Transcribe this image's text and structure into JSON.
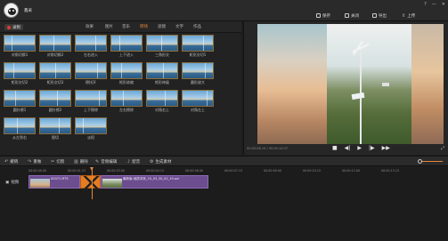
{
  "app": {
    "title": "鑫采"
  },
  "titlebar": {
    "actions": [
      {
        "label": "保存",
        "icon": "save-icon"
      },
      {
        "label": "关闭",
        "icon": "close-project-icon"
      },
      {
        "label": "导出",
        "icon": "export-icon"
      },
      {
        "label": "上传",
        "icon": "upload-icon"
      }
    ],
    "window_controls": [
      "?",
      "—",
      "✕"
    ]
  },
  "left_panel": {
    "record_button": "录制",
    "tabs": [
      "效果",
      "图片",
      "音乐",
      "转场",
      "滤镜",
      "文字",
      "作品"
    ],
    "active_tab": "转场",
    "transitions": [
      "对角切换1",
      "对角切换2",
      "左右进入",
      "上下进入",
      "三角形交",
      "矩形交切1",
      "矩形交切2",
      "矩形交切3",
      "擦拭开",
      "矩形收缩",
      "矩形伸展",
      "圆形放大",
      "圆针擦1",
      "圆针擦2",
      "上下擦除",
      "左右擦除",
      "对角右上",
      "对角左上",
      "从左到右",
      "图切",
      "淡阳"
    ]
  },
  "preview": {
    "time": "00:00:06.19 / 00:00:14.07",
    "controls": [
      "stop-icon",
      "prev-frame-icon",
      "play-icon",
      "next-frame-icon",
      "skip-end-icon"
    ]
  },
  "toolbar": {
    "items": [
      "撤销",
      "重做",
      "切割",
      "删除",
      "音频编辑",
      "配音",
      "生成素材"
    ]
  },
  "timeline": {
    "ticks": [
      "00:00:00.00",
      "00:00:01.15",
      "00:00:03.00",
      "00:00:04.15",
      "00:00:06.00",
      "00:00:07.15",
      "00:00:09.00",
      "00:00:10.15",
      "00:00:12.00",
      "00:00:13.15"
    ],
    "track_label": "视频",
    "clips": [
      {
        "name": "00071.MTS"
      },
      {
        "name": "最新版-地质冲采_20_03_30_02_19.avi"
      }
    ]
  },
  "colors": {
    "accent": "#e8873a",
    "clip": "#6c4d8e",
    "transition": "#e57c21"
  }
}
